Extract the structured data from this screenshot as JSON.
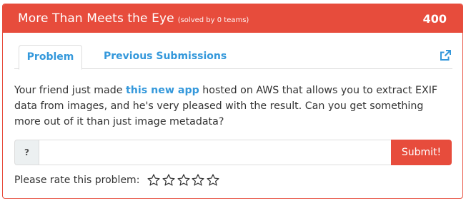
{
  "problem": {
    "title": "More Than Meets the Eye",
    "solved_note": "(solved by 0 teams)",
    "points": "400"
  },
  "tabs": [
    {
      "label": "Problem",
      "active": true
    },
    {
      "label": "Previous Submissions",
      "active": false
    }
  ],
  "description": {
    "before_link": "Your friend just made ",
    "link_text": "this new app",
    "after_link": " hosted on AWS that allows you to extract EXIF data from images, and he's very pleased with the result. Can you get something more out of it than just image metadata?"
  },
  "answer": {
    "addon_label": "?",
    "value": "",
    "placeholder": "",
    "submit_label": "Submit!"
  },
  "rating": {
    "label": "Please rate this problem:",
    "stars": 5,
    "selected": 0
  },
  "colors": {
    "accent": "#e74c3c",
    "link": "#3498db"
  },
  "icons": {
    "external_link": "external-link-icon",
    "star": "star-outline-icon"
  }
}
